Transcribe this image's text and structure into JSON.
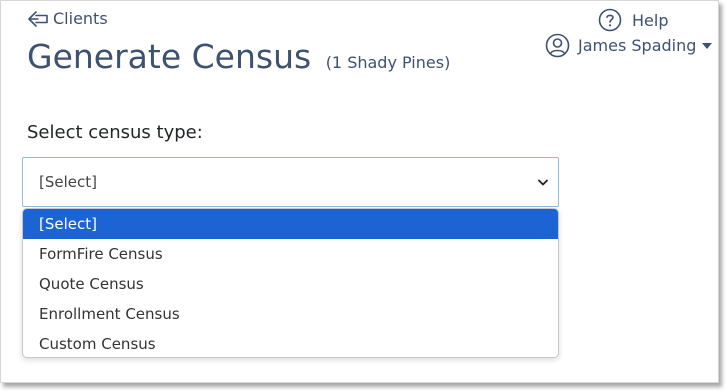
{
  "header": {
    "back_label": "Clients",
    "title": "Generate Census",
    "subtitle": "(1 Shady Pines)",
    "help_label": "Help",
    "user_name": "James Spading"
  },
  "form": {
    "select_label": "Select census type:",
    "selected_value": "[Select]",
    "options": [
      {
        "label": "[Select]",
        "selected": true
      },
      {
        "label": "FormFire Census",
        "selected": false
      },
      {
        "label": "Quote Census",
        "selected": false
      },
      {
        "label": "Enrollment Census",
        "selected": false
      },
      {
        "label": "Custom Census",
        "selected": false
      }
    ]
  },
  "icons": {
    "back": "arrow-left-icon",
    "help": "question-circle-icon",
    "user": "user-circle-icon",
    "user_menu": "caret-down-icon",
    "select": "chevron-down-icon"
  },
  "colors": {
    "text_primary": "#3d5170",
    "select_border": "#8fb9e6",
    "option_highlight": "#1c64d3"
  }
}
